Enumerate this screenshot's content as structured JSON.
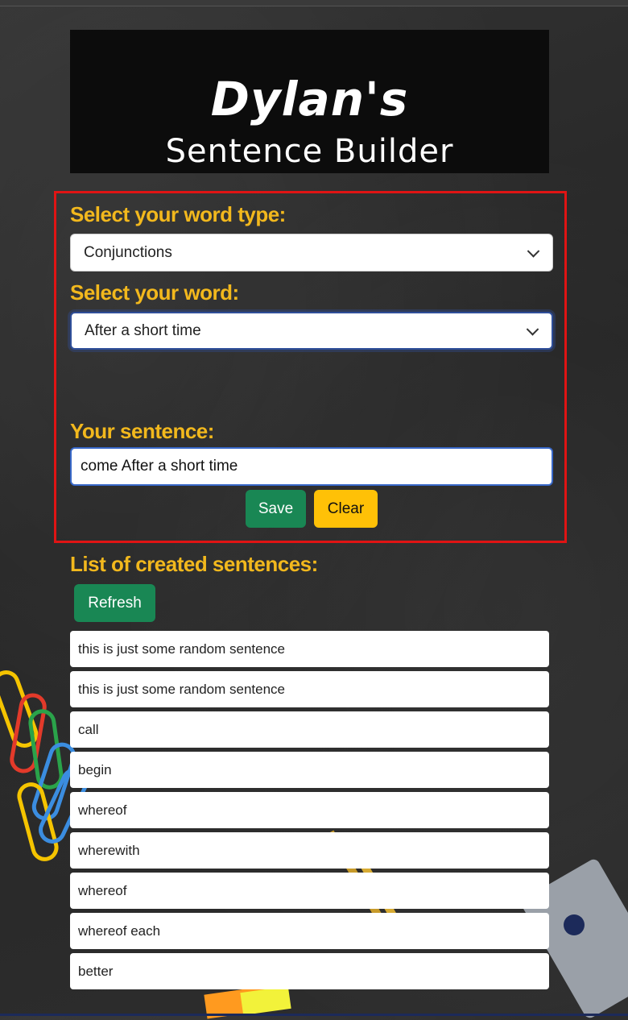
{
  "logo": {
    "name": "Dylan's",
    "subtitle": "Sentence Builder"
  },
  "form": {
    "word_type_label": "Select your word type:",
    "word_type_value": "Conjunctions",
    "word_label": "Select your word:",
    "word_value": "After a short time",
    "sentence_label": "Your sentence:",
    "sentence_value": "come After a short time",
    "save_label": "Save",
    "clear_label": "Clear"
  },
  "list": {
    "heading": "List of created sentences:",
    "refresh_label": "Refresh",
    "items": [
      "this is just some random sentence",
      "this is just some random sentence",
      "call",
      "begin",
      "whereof",
      "wherewith",
      "whereof",
      "whereof each",
      "better"
    ]
  },
  "colors": {
    "label": "#f2b81d",
    "save": "#198754",
    "clear": "#ffc107",
    "highlight_border": "#e01414"
  }
}
